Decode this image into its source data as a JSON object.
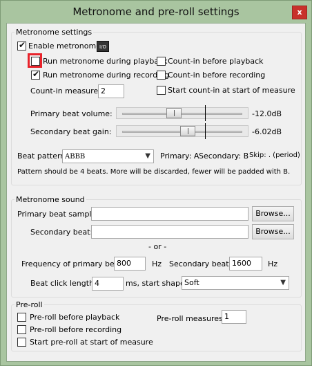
{
  "window": {
    "title": "Metronome and pre-roll settings",
    "close_label": "x"
  },
  "metronome_settings": {
    "group_title": "Metronome settings",
    "enable_label": "Enable metronome",
    "enable_checked": true,
    "io_label": "I/O",
    "run_playback_label": "Run metronome during playback",
    "run_playback_checked": false,
    "run_recording_label": "Run metronome during recording",
    "run_recording_checked": true,
    "countin_playback_label": "Count-in before playback",
    "countin_playback_checked": false,
    "countin_recording_label": "Count-in before recording",
    "countin_recording_checked": false,
    "countin_measures_label": "Count-in measures:",
    "countin_measures_value": "2",
    "start_countin_label": "Start count-in at start of measure",
    "start_countin_checked": false,
    "primary_volume_label": "Primary beat volume:",
    "primary_volume_value": "-12.0dB",
    "secondary_gain_label": "Secondary beat gain:",
    "secondary_gain_value": "-6.02dB",
    "beat_pattern_label": "Beat pattern:",
    "beat_pattern_value": "ABBB",
    "pattern_legend_primary": "Primary: A",
    "pattern_legend_secondary": "Secondary: B",
    "pattern_legend_skip": "Skip: . (period)",
    "pattern_note": "Pattern should be 4 beats. More will be discarded, fewer will be padded with B."
  },
  "metronome_sound": {
    "group_title": "Metronome sound",
    "primary_sample_label": "Primary beat sample:",
    "primary_sample_value": "",
    "browse_label": "Browse...",
    "secondary_beat_label": "Secondary beat:",
    "secondary_beat_value": "",
    "or_label": "- or -",
    "freq_primary_label": "Frequency of primary beat:",
    "freq_primary_value": "800",
    "hz_label": "Hz",
    "secondary_beat_freq_label": "Secondary beat:",
    "secondary_beat_freq_value": "1600",
    "click_length_label": "Beat click length:",
    "click_length_value": "4",
    "click_length_unit": "ms, start shape:",
    "start_shape_value": "Soft"
  },
  "preroll": {
    "group_title": "Pre-roll",
    "before_playback_label": "Pre-roll before playback",
    "before_recording_label": "Pre-roll before recording",
    "start_at_measure_label": "Start pre-roll at start of measure",
    "measures_label": "Pre-roll measures:",
    "measures_value": "1"
  }
}
